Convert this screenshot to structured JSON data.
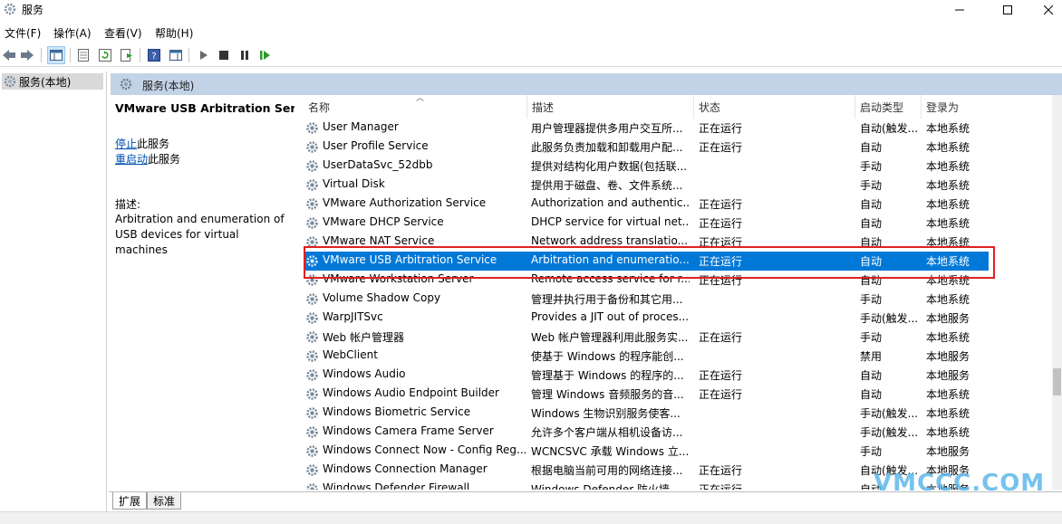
{
  "window": {
    "title": "服务"
  },
  "menu": [
    "文件(F)",
    "操作(A)",
    "查看(V)",
    "帮助(H)"
  ],
  "tree": {
    "item": "服务(本地)"
  },
  "panel": {
    "header": "服务(本地)"
  },
  "details": {
    "service_name": "VMware USB Arbitration Service",
    "stop_link": "停止",
    "stop_suffix": "此服务",
    "restart_link": "重启动",
    "restart_suffix": "此服务",
    "desc_label": "描述:",
    "desc_text": "Arbitration and enumeration of USB devices for virtual machines"
  },
  "columns": {
    "name": "名称",
    "desc": "描述",
    "status": "状态",
    "startup": "启动类型",
    "logon": "登录为"
  },
  "rows": [
    {
      "name": "User Manager",
      "desc": "用户管理器提供多用户交互所...",
      "status": "正在运行",
      "startup": "自动(触发...",
      "logon": "本地系统"
    },
    {
      "name": "User Profile Service",
      "desc": "此服务负责加载和卸载用户配...",
      "status": "正在运行",
      "startup": "自动",
      "logon": "本地系统"
    },
    {
      "name": "UserDataSvc_52dbb",
      "desc": "提供对结构化用户数据(包括联...",
      "status": "",
      "startup": "手动",
      "logon": "本地系统"
    },
    {
      "name": "Virtual Disk",
      "desc": "提供用于磁盘、卷、文件系统...",
      "status": "",
      "startup": "手动",
      "logon": "本地系统"
    },
    {
      "name": "VMware Authorization Service",
      "desc": "Authorization and authentic...",
      "status": "正在运行",
      "startup": "自动",
      "logon": "本地系统"
    },
    {
      "name": "VMware DHCP Service",
      "desc": "DHCP service for virtual net...",
      "status": "正在运行",
      "startup": "自动",
      "logon": "本地系统"
    },
    {
      "name": "VMware NAT Service",
      "desc": "Network address translatio...",
      "status": "正在运行",
      "startup": "自动",
      "logon": "本地系统"
    },
    {
      "name": "VMware USB Arbitration Service",
      "desc": "Arbitration and enumeratio...",
      "status": "正在运行",
      "startup": "自动",
      "logon": "本地系统",
      "selected": true
    },
    {
      "name": "VMware Workstation Server",
      "desc": "Remote access service for r...",
      "status": "正在运行",
      "startup": "自动",
      "logon": "本地系统"
    },
    {
      "name": "Volume Shadow Copy",
      "desc": "管理并执行用于备份和其它用...",
      "status": "",
      "startup": "手动",
      "logon": "本地系统"
    },
    {
      "name": "WarpJITSvc",
      "desc": "Provides a JIT out of proces...",
      "status": "",
      "startup": "手动(触发...",
      "logon": "本地服务"
    },
    {
      "name": "Web 帐户管理器",
      "desc": "Web 帐户管理器利用此服务实...",
      "status": "正在运行",
      "startup": "手动",
      "logon": "本地系统"
    },
    {
      "name": "WebClient",
      "desc": "使基于 Windows 的程序能创...",
      "status": "",
      "startup": "禁用",
      "logon": "本地服务"
    },
    {
      "name": "Windows Audio",
      "desc": "管理基于 Windows 的程序的...",
      "status": "正在运行",
      "startup": "自动",
      "logon": "本地服务"
    },
    {
      "name": "Windows Audio Endpoint Builder",
      "desc": "管理 Windows 音频服务的音...",
      "status": "正在运行",
      "startup": "自动",
      "logon": "本地系统"
    },
    {
      "name": "Windows Biometric Service",
      "desc": "Windows 生物识别服务使客...",
      "status": "",
      "startup": "手动(触发...",
      "logon": "本地系统"
    },
    {
      "name": "Windows Camera Frame Server",
      "desc": "允许多个客户端从相机设备访...",
      "status": "",
      "startup": "手动(触发...",
      "logon": "本地系统"
    },
    {
      "name": "Windows Connect Now - Config Reg...",
      "desc": "WCNCSVC 承载 Windows 立...",
      "status": "",
      "startup": "手动",
      "logon": "本地服务"
    },
    {
      "name": "Windows Connection Manager",
      "desc": "根据电脑当前可用的网络连接...",
      "status": "正在运行",
      "startup": "自动(触发...",
      "logon": "本地服务"
    },
    {
      "name": "Windows Defender Firewall",
      "desc": "Windows Defender 防火墙...",
      "status": "正在运行",
      "startup": "自动",
      "logon": "本地服务"
    }
  ],
  "tabs": [
    "扩展",
    "标准"
  ],
  "watermark": "VMCCC.COM",
  "colors": {
    "selection": "#0078d7",
    "highlight_box": "#e02020",
    "panel_header": "#c3d3e7",
    "link": "#0050b0"
  }
}
